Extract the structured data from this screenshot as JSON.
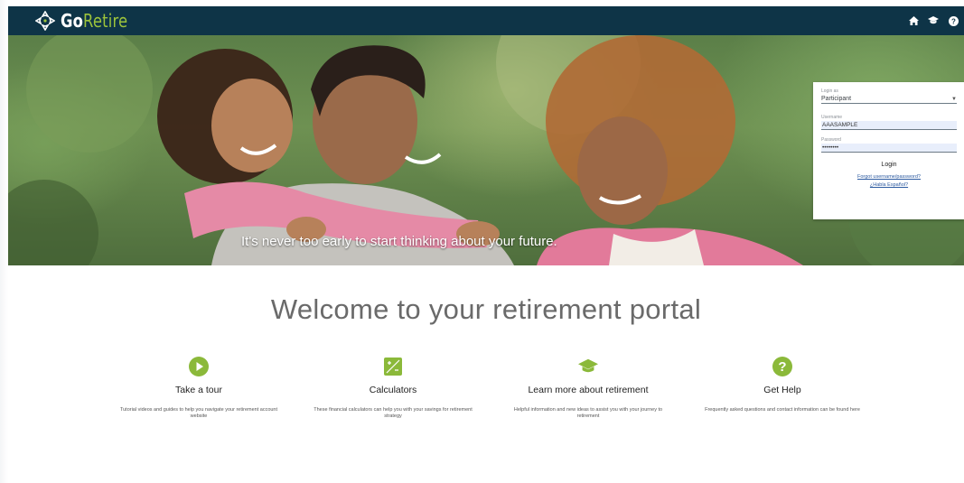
{
  "brand": {
    "go": "Go",
    "retire": "Retire"
  },
  "nav_icons": [
    "home-icon",
    "graduation-cap-icon",
    "help-icon"
  ],
  "hero": {
    "tagline": "It's never too early to start thinking about your future."
  },
  "login": {
    "login_as_label": "Login as",
    "login_as_value": "Participant",
    "username_label": "Username",
    "username_value": "AAASAMPLE",
    "password_label": "Password",
    "password_value": "••••••••",
    "login_button": "Login",
    "forgot_link": "Forgot username/password?",
    "spanish_link": "¿Habla Español?"
  },
  "welcome": "Welcome to your retirement portal",
  "features": [
    {
      "icon": "play-circle-icon",
      "title": "Take a tour",
      "desc": "Tutorial videos and guides to help you navigate your retirement account website"
    },
    {
      "icon": "calculator-icon",
      "title": "Calculators",
      "desc": "These financial calculators can help you with your savings for retirement strategy"
    },
    {
      "icon": "graduation-cap-icon",
      "title": "Learn more about retirement",
      "desc": "Helpful information and new ideas to assist you with your journey to retirement"
    },
    {
      "icon": "question-circle-icon",
      "title": "Get Help",
      "desc": "Frequently asked questions and contact information can be found here"
    }
  ],
  "colors": {
    "navbar": "#0e3447",
    "accent_green": "#8bb93a",
    "link_blue": "#2c5aa0"
  }
}
